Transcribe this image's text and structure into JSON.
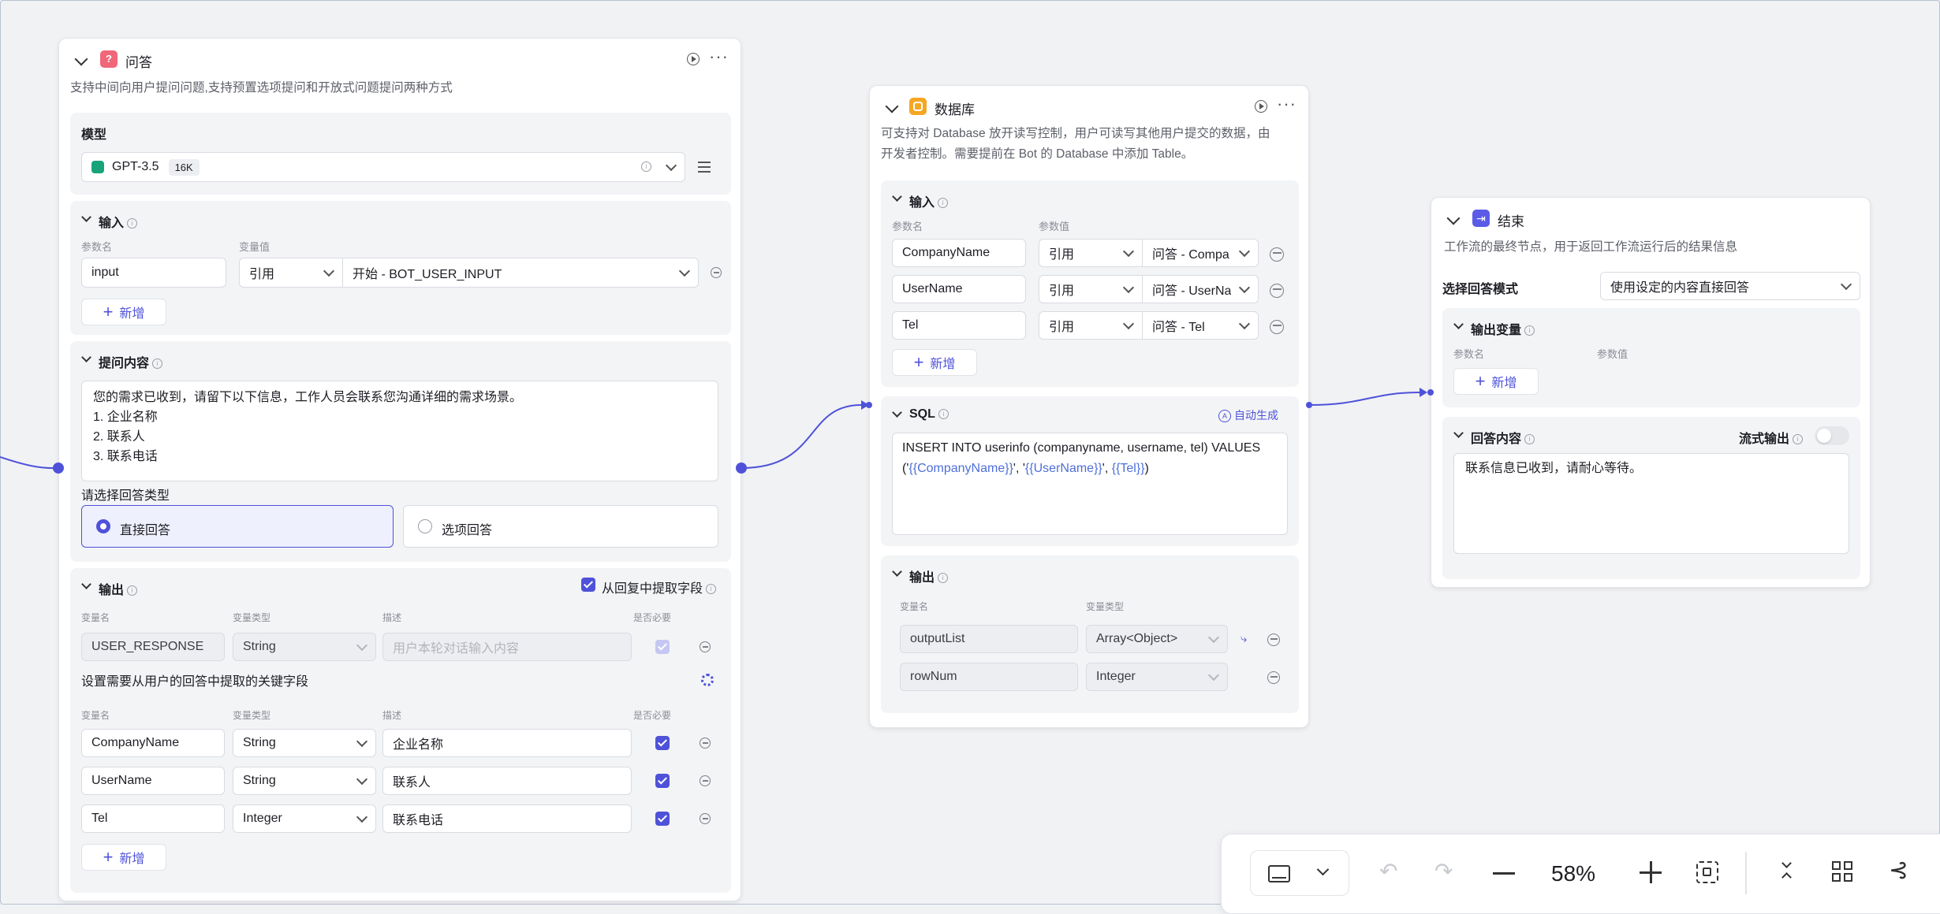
{
  "node_qa": {
    "title": "问答",
    "description": "支持中间向用户提问问题,支持预置选项提问和开放式问题提问两种方式",
    "model": {
      "label": "模型",
      "name": "GPT-3.5",
      "context": "16K"
    },
    "input": {
      "title": "输入",
      "col_name": "参数名",
      "col_value": "变量值",
      "rows": [
        {
          "name": "input",
          "type": "引用",
          "value": "开始 - BOT_USER_INPUT"
        }
      ],
      "add_label": "新增"
    },
    "question": {
      "title": "提问内容",
      "lines": [
        "您的需求已收到，请留下以下信息，工作人员会联系您沟通详细的需求场景。",
        "1. 企业名称",
        "2. 联系人",
        "3. 联系电话"
      ],
      "answer_type_label": "请选择回答类型",
      "option_direct": "直接回答",
      "option_choice": "选项回答"
    },
    "output": {
      "title": "输出",
      "extract_label": "从回复中提取字段",
      "col_name": "变量名",
      "col_type": "变量类型",
      "col_desc": "描述",
      "col_required": "是否必要",
      "fixed_row": {
        "name": "USER_RESPONSE",
        "type": "String",
        "placeholder": "用户本轮对话输入内容"
      },
      "extract_title": "设置需要从用户的回答中提取的关键字段",
      "rows": [
        {
          "name": "CompanyName",
          "type": "String",
          "desc": "企业名称"
        },
        {
          "name": "UserName",
          "type": "String",
          "desc": "联系人"
        },
        {
          "name": "Tel",
          "type": "Integer",
          "desc": "联系电话"
        }
      ],
      "add_label": "新增"
    }
  },
  "node_db": {
    "title": "数据库",
    "description_lines": [
      "可支持对 Database 放开读写控制，用户可读写其他用户提交的数据，由",
      "开发者控制。需要提前在 Bot 的 Database 中添加 Table。"
    ],
    "input": {
      "title": "输入",
      "col_name": "参数名",
      "col_value": "参数值",
      "rows": [
        {
          "name": "CompanyName",
          "type": "引用",
          "value": "问答 - Compa"
        },
        {
          "name": "UserName",
          "type": "引用",
          "value": "问答 - UserNa"
        },
        {
          "name": "Tel",
          "type": "引用",
          "value": "问答 - Tel"
        }
      ],
      "add_label": "新增"
    },
    "sql": {
      "title": "SQL",
      "auto_label": "自动生成",
      "line1": "INSERT INTO userinfo (companyname, username, tel) VALUES",
      "line2": {
        "p1": "('",
        "v1": "{{CompanyName}}",
        "p2": "', '",
        "v2": "{{UserName}}",
        "p3": "', ",
        "v3": "{{Tel}}",
        "p4": ")"
      }
    },
    "output": {
      "title": "输出",
      "col_name": "变量名",
      "col_type": "变量类型",
      "rows": [
        {
          "name": "outputList",
          "type": "Array<Object>"
        },
        {
          "name": "rowNum",
          "type": "Integer"
        }
      ]
    }
  },
  "node_end": {
    "title": "结束",
    "description": "工作流的最终节点，用于返回工作流运行后的结果信息",
    "mode_label": "选择回答模式",
    "mode_value": "使用设定的内容直接回答",
    "output_vars": {
      "title": "输出变量",
      "col_name": "参数名",
      "col_value": "参数值",
      "add_label": "新增"
    },
    "answer": {
      "title": "回答内容",
      "stream_label": "流式输出",
      "content": "联系信息已收到，请耐心等待。"
    }
  },
  "toolbar": {
    "zoom": "58%"
  },
  "colors": {
    "accent": "#4e52d9",
    "qa_icon": "#f0677a",
    "db_icon": "#f5a623",
    "end_icon": "#5b5be8"
  }
}
